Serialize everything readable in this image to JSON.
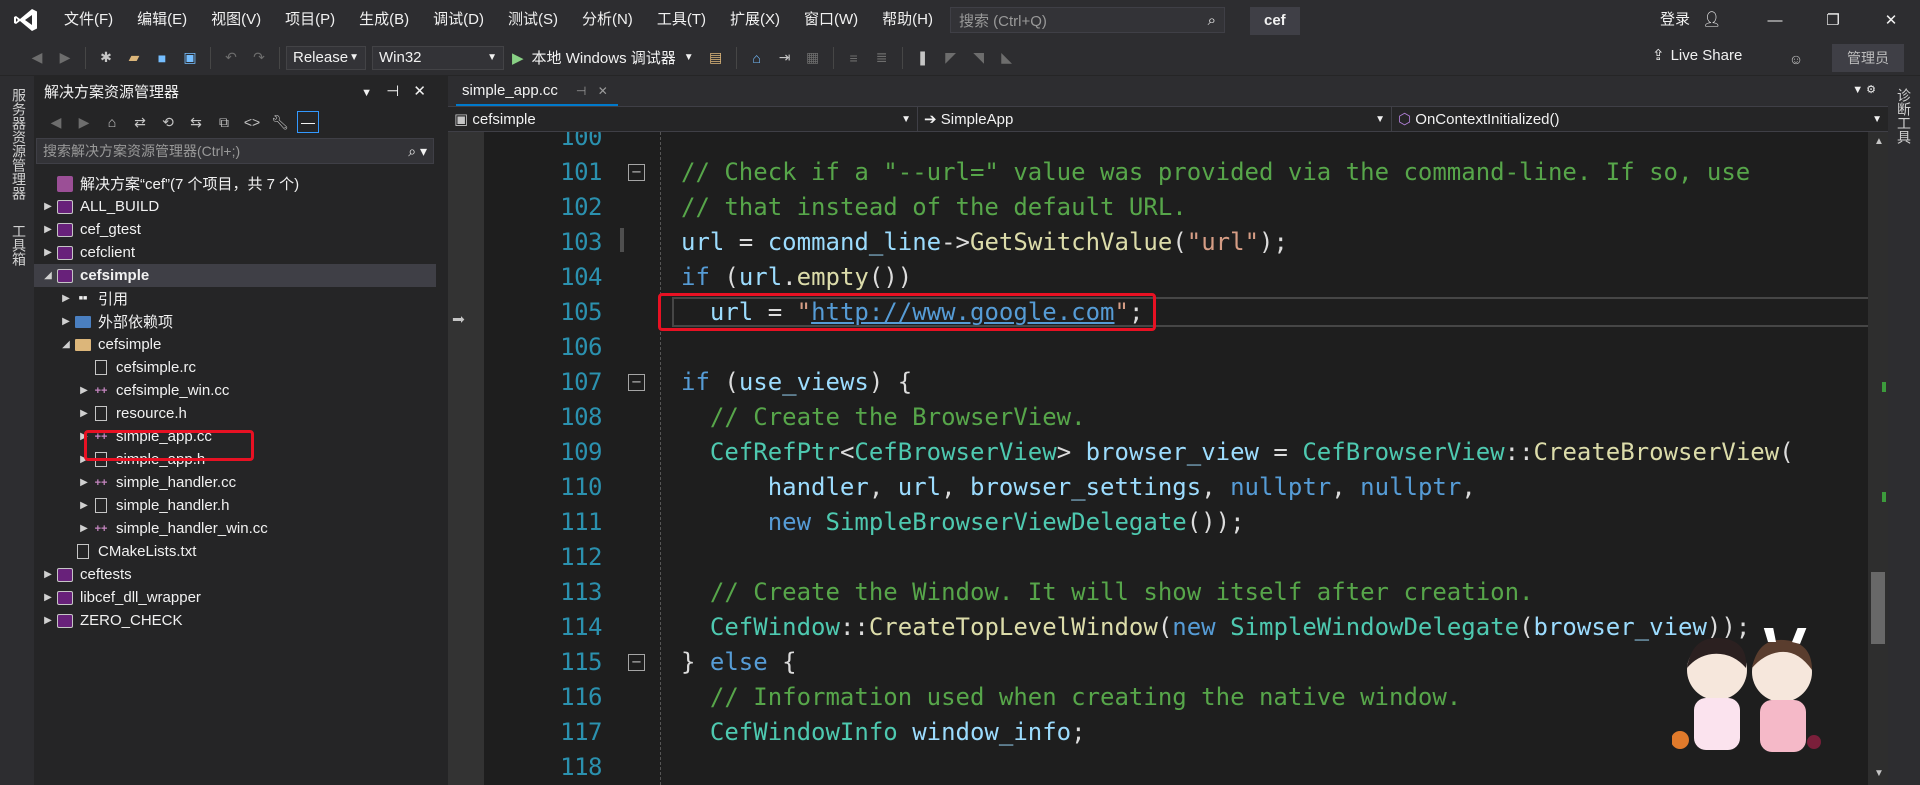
{
  "menubar": {
    "items": [
      "文件(F)",
      "编辑(E)",
      "视图(V)",
      "项目(P)",
      "生成(B)",
      "调试(D)",
      "测试(S)",
      "分析(N)",
      "工具(T)",
      "扩展(X)",
      "窗口(W)",
      "帮助(H)"
    ],
    "search_placeholder": "搜索 (Ctrl+Q)",
    "solution_name": "cef",
    "login": "登录"
  },
  "toolbar": {
    "configuration": "Release",
    "platform": "Win32",
    "run_label": "本地 Windows 调试器",
    "live_share": "Live Share",
    "admin": "管理员"
  },
  "side_tabs": {
    "left_1": "服务器资源管理器",
    "left_2": "工具箱",
    "right_1": "诊断工具"
  },
  "solution_explorer": {
    "title": "解决方案资源管理器",
    "search_placeholder": "搜索解决方案资源管理器(Ctrl+;)",
    "tree": [
      {
        "label": "解决方案“cef”(7 个项目，共 7 个)",
        "level": 0,
        "kind": "solution",
        "arrow": ""
      },
      {
        "label": "ALL_BUILD",
        "level": 0,
        "kind": "project",
        "arrow": "▶"
      },
      {
        "label": "cef_gtest",
        "level": 0,
        "kind": "project",
        "arrow": "▶"
      },
      {
        "label": "cefclient",
        "level": 0,
        "kind": "project",
        "arrow": "▶"
      },
      {
        "label": "cefsimple",
        "level": 0,
        "kind": "project",
        "arrow": "◢",
        "selected": true,
        "bold": true
      },
      {
        "label": "引用",
        "level": 1,
        "kind": "refs",
        "arrow": "▶"
      },
      {
        "label": "外部依赖项",
        "level": 1,
        "kind": "deps",
        "arrow": "▶"
      },
      {
        "label": "cefsimple",
        "level": 1,
        "kind": "folder",
        "arrow": "◢"
      },
      {
        "label": "cefsimple.rc",
        "level": 2,
        "kind": "file",
        "arrow": ""
      },
      {
        "label": "cefsimple_win.cc",
        "level": 2,
        "kind": "cpp",
        "arrow": "▶"
      },
      {
        "label": "resource.h",
        "level": 2,
        "kind": "file",
        "arrow": "▶"
      },
      {
        "label": "simple_app.cc",
        "level": 2,
        "kind": "cpp",
        "arrow": "▶",
        "highlighted": true
      },
      {
        "label": "simple_app.h",
        "level": 2,
        "kind": "file",
        "arrow": "▶"
      },
      {
        "label": "simple_handler.cc",
        "level": 2,
        "kind": "cpp",
        "arrow": "▶"
      },
      {
        "label": "simple_handler.h",
        "level": 2,
        "kind": "file",
        "arrow": "▶"
      },
      {
        "label": "simple_handler_win.cc",
        "level": 2,
        "kind": "cpp",
        "arrow": "▶"
      },
      {
        "label": "CMakeLists.txt",
        "level": 1,
        "kind": "file",
        "arrow": ""
      },
      {
        "label": "ceftests",
        "level": 0,
        "kind": "project",
        "arrow": "▶"
      },
      {
        "label": "libcef_dll_wrapper",
        "level": 0,
        "kind": "project",
        "arrow": "▶"
      },
      {
        "label": "ZERO_CHECK",
        "level": 0,
        "kind": "project",
        "arrow": "▶"
      }
    ]
  },
  "editor": {
    "tab_label": "simple_app.cc",
    "nav_project": "cefsimple",
    "nav_class": "SimpleApp",
    "nav_member": "OnContextInitialized()",
    "lines": [
      {
        "n": "100",
        "fold": false,
        "tokens": []
      },
      {
        "n": "101",
        "fold": true,
        "tokens": [
          [
            "c-com",
            "// Check if a \"--url=\" value was provided via the command-line. If so, use"
          ]
        ]
      },
      {
        "n": "102",
        "fold": false,
        "tokens": [
          [
            "c-com",
            "// that instead of the default URL."
          ]
        ]
      },
      {
        "n": "103",
        "fold": false,
        "tokens": [
          [
            "c-var",
            "url"
          ],
          [
            "",
            " = "
          ],
          [
            "c-var",
            "command_line"
          ],
          [
            "",
            "->"
          ],
          [
            "c-fn",
            "GetSwitchValue"
          ],
          [
            "",
            "("
          ],
          [
            "c-str",
            "\"url\""
          ],
          [
            "",
            ");"
          ]
        ]
      },
      {
        "n": "104",
        "fold": false,
        "tokens": [
          [
            "c-kw",
            "if"
          ],
          [
            "",
            " ("
          ],
          [
            "c-var",
            "url"
          ],
          [
            "",
            "."
          ],
          [
            "c-fn",
            "empty"
          ],
          [
            "",
            "())"
          ]
        ]
      },
      {
        "n": "105",
        "fold": false,
        "indent": 1,
        "tokens": [
          [
            "c-var",
            "url"
          ],
          [
            "",
            " = "
          ],
          [
            "c-str",
            "\""
          ],
          [
            "c-url",
            "http://www.google.com"
          ],
          [
            "c-str",
            "\""
          ],
          [
            "",
            ";"
          ]
        ]
      },
      {
        "n": "106",
        "fold": false,
        "tokens": []
      },
      {
        "n": "107",
        "fold": true,
        "tokens": [
          [
            "c-kw",
            "if"
          ],
          [
            "",
            " ("
          ],
          [
            "c-var",
            "use_views"
          ],
          [
            "",
            ") {"
          ]
        ]
      },
      {
        "n": "108",
        "fold": false,
        "indent": 1,
        "tokens": [
          [
            "c-com",
            "// Create the BrowserView."
          ]
        ]
      },
      {
        "n": "109",
        "fold": false,
        "indent": 1,
        "tokens": [
          [
            "c-type",
            "CefRefPtr"
          ],
          [
            "",
            "<"
          ],
          [
            "c-type",
            "CefBrowserView"
          ],
          [
            "",
            "> "
          ],
          [
            "c-var",
            "browser_view"
          ],
          [
            "",
            " = "
          ],
          [
            "c-type",
            "CefBrowserView"
          ],
          [
            "",
            "::"
          ],
          [
            "c-fn",
            "CreateBrowserView"
          ],
          [
            "",
            "("
          ]
        ]
      },
      {
        "n": "110",
        "fold": false,
        "indent": 3,
        "tokens": [
          [
            "c-var",
            "handler"
          ],
          [
            "",
            ", "
          ],
          [
            "c-var",
            "url"
          ],
          [
            "",
            ", "
          ],
          [
            "c-var",
            "browser_settings"
          ],
          [
            "",
            ", "
          ],
          [
            "c-kw",
            "nullptr"
          ],
          [
            "",
            ", "
          ],
          [
            "c-kw",
            "nullptr"
          ],
          [
            "",
            ","
          ]
        ]
      },
      {
        "n": "111",
        "fold": false,
        "indent": 3,
        "tokens": [
          [
            "c-kw",
            "new"
          ],
          [
            "",
            " "
          ],
          [
            "c-type",
            "SimpleBrowserViewDelegate"
          ],
          [
            "",
            "());"
          ]
        ]
      },
      {
        "n": "112",
        "fold": false,
        "tokens": []
      },
      {
        "n": "113",
        "fold": false,
        "indent": 1,
        "tokens": [
          [
            "c-com",
            "// Create the Window. It will show itself after creation."
          ]
        ]
      },
      {
        "n": "114",
        "fold": false,
        "indent": 1,
        "tokens": [
          [
            "c-type",
            "CefWindow"
          ],
          [
            "",
            "::"
          ],
          [
            "c-fn",
            "CreateTopLevelWindow"
          ],
          [
            "",
            "("
          ],
          [
            "c-kw",
            "new"
          ],
          [
            "",
            " "
          ],
          [
            "c-type",
            "SimpleWindowDelegate"
          ],
          [
            "",
            "("
          ],
          [
            "c-var",
            "browser_view"
          ],
          [
            "",
            "));"
          ]
        ]
      },
      {
        "n": "115",
        "fold": true,
        "tokens": [
          [
            "",
            "} "
          ],
          [
            "c-kw",
            "else"
          ],
          [
            "",
            " {"
          ]
        ]
      },
      {
        "n": "116",
        "fold": false,
        "indent": 1,
        "tokens": [
          [
            "c-com",
            "// Information used when creating the native window."
          ]
        ]
      },
      {
        "n": "117",
        "fold": false,
        "indent": 1,
        "tokens": [
          [
            "c-type",
            "CefWindowInfo"
          ],
          [
            "",
            " "
          ],
          [
            "c-var",
            "window_info"
          ],
          [
            "",
            ";"
          ]
        ]
      },
      {
        "n": "118",
        "fold": false,
        "tokens": []
      }
    ]
  }
}
